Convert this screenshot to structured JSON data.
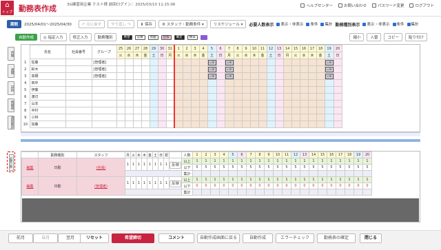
{
  "header": {
    "logo_label": "トップへ",
    "title": "勤務表作成",
    "company": "3G練習用企業 テスト様 前回ログイン：2025/03/10 11:15:06",
    "links": [
      "ヘルプセンター",
      "お問い合わせ",
      "パスワード変更",
      "ログアウト"
    ]
  },
  "toolbar": {
    "period_label": "期間",
    "period_value": "2025/04/01～2025/04/30",
    "undo": "元に戻す",
    "redo": "やり直し",
    "save": "保存",
    "staff_select": "スタッフ・勤務条件",
    "request_schedule": "リスケジュール",
    "required_display": "必要人数表示",
    "opt_show_hide": "表示・非表示",
    "opt_condition": "条件",
    "opt_total": "集計",
    "shift_type_display": "勤務種別表示",
    "opt2_show_hide": "表示・非表示",
    "opt2_condition": "条件",
    "opt2_total": "集計"
  },
  "toolbar2": {
    "auto": "自動作成",
    "designated": "指定入力",
    "correction": "修正入力",
    "shift_type": "勤務種別",
    "legends": [
      "希望",
      "公休",
      "有給",
      "出張",
      "確定",
      "休日"
    ],
    "shrink": "縮小",
    "swap": "入替",
    "copy": "コピー",
    "paste": "貼り付け"
  },
  "side_tabs": [
    "月間",
    "週間",
    "日別",
    "時間帯",
    "週別集計"
  ],
  "grid": {
    "col_name": "氏名",
    "col_id": "社員番号",
    "col_group": "グループ",
    "days": [
      "25",
      "26",
      "27",
      "28",
      "29",
      "30",
      "31",
      "1",
      "2",
      "3",
      "4",
      "5",
      "6",
      "7",
      "8",
      "9",
      "10",
      "11",
      "12",
      "13",
      "14",
      "15",
      "16",
      "17",
      "18",
      "19",
      "20"
    ],
    "weekdays": [
      "火",
      "水",
      "木",
      "金",
      "土",
      "日",
      "月",
      "火",
      "水",
      "木",
      "金",
      "土",
      "日",
      "月",
      "火",
      "水",
      "木",
      "金",
      "土",
      "日",
      "月",
      "火",
      "水",
      "木",
      "金",
      "土",
      "日"
    ],
    "rows": [
      {
        "no": "1",
        "name": "佐藤",
        "group": "[管理者]"
      },
      {
        "no": "2",
        "name": "鈴木",
        "group": "[管理者]"
      },
      {
        "no": "3",
        "name": "高橋",
        "group": "[管理者]"
      },
      {
        "no": "4",
        "name": "田中",
        "group": ""
      },
      {
        "no": "5",
        "name": "伊藤",
        "group": ""
      },
      {
        "no": "6",
        "name": "渡辺",
        "group": ""
      },
      {
        "no": "7",
        "name": "山本",
        "group": ""
      },
      {
        "no": "8",
        "name": "中村",
        "group": ""
      },
      {
        "no": "9",
        "name": "小林",
        "group": ""
      },
      {
        "no": "10",
        "name": "加藤",
        "group": ""
      }
    ],
    "kokyu_label": "公休"
  },
  "bottom": {
    "side_tab": "必要人数",
    "col_shift": "勤務種別",
    "col_staff": "スタッフ",
    "weekdays": [
      "月",
      "火",
      "水",
      "木",
      "金",
      "土",
      "日",
      "祝"
    ],
    "col_persons": "人数",
    "reflect": "反映",
    "rows": [
      {
        "edit": "編集",
        "shift": "日勤",
        "staff": "(全員)",
        "limits": [
          "以上",
          "以下",
          "集計"
        ]
      },
      {
        "edit": "編集",
        "shift": "日勤",
        "staff": "(管理者)",
        "limits": [
          "以上",
          "以下",
          "集計"
        ]
      }
    ]
  },
  "footer": {
    "prev_month": "前月",
    "this_month": "当月",
    "next_month": "翌月",
    "reset": "リセット",
    "request": "希望締切",
    "comment": "コメント",
    "back": "自動作成画面に戻る",
    "auto_create": "自動作成",
    "error_check": "エラーチェック",
    "confirm": "勤務表の確定",
    "close": "閉じる"
  }
}
